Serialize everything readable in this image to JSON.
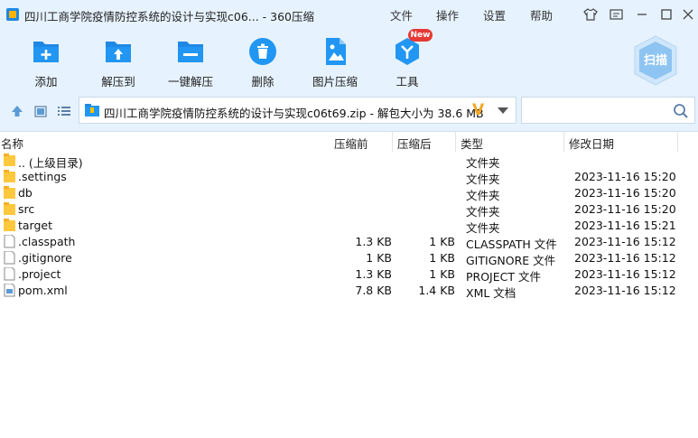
{
  "titlebar": {
    "title": "四川工商学院疫情防控系统的设计与实现c06... - 360压缩",
    "menu": [
      "文件",
      "操作",
      "设置",
      "帮助"
    ]
  },
  "toolbar": {
    "tools": [
      {
        "label": "添加",
        "icon": "add-icon"
      },
      {
        "label": "解压到",
        "icon": "extract-to-icon"
      },
      {
        "label": "一键解压",
        "icon": "one-click-extract-icon"
      },
      {
        "label": "删除",
        "icon": "delete-icon"
      },
      {
        "label": "图片压缩",
        "icon": "image-compress-icon"
      },
      {
        "label": "工具",
        "icon": "tools-icon"
      }
    ],
    "new_badge": "New",
    "scan_label": "扫描"
  },
  "address": {
    "path": "四川工商学院疫情防控系统的设计与实现c06t69.zip - 解包大小为 38.6 MB",
    "v_mark": "V"
  },
  "columns": {
    "name": "名称",
    "compressed": "压缩前",
    "after": "压缩后",
    "type": "类型",
    "modified": "修改日期"
  },
  "files": [
    {
      "name": ".. (上级目录)",
      "before": "",
      "after": "",
      "type": "文件夹",
      "date": "",
      "kind": "folder"
    },
    {
      "name": ".settings",
      "before": "",
      "after": "",
      "type": "文件夹",
      "date": "2023-11-16 15:20",
      "kind": "folder"
    },
    {
      "name": "db",
      "before": "",
      "after": "",
      "type": "文件夹",
      "date": "2023-11-16 15:20",
      "kind": "folder"
    },
    {
      "name": "src",
      "before": "",
      "after": "",
      "type": "文件夹",
      "date": "2023-11-16 15:20",
      "kind": "folder"
    },
    {
      "name": "target",
      "before": "",
      "after": "",
      "type": "文件夹",
      "date": "2023-11-16 15:21",
      "kind": "folder"
    },
    {
      "name": ".classpath",
      "before": "1.3 KB",
      "after": "1 KB",
      "type": "CLASSPATH 文件",
      "date": "2023-11-16 15:12",
      "kind": "file"
    },
    {
      "name": ".gitignore",
      "before": "1 KB",
      "after": "1 KB",
      "type": "GITIGNORE 文件",
      "date": "2023-11-16 15:12",
      "kind": "file"
    },
    {
      "name": ".project",
      "before": "1.3 KB",
      "after": "1 KB",
      "type": "PROJECT 文件",
      "date": "2023-11-16 15:12",
      "kind": "file"
    },
    {
      "name": "pom.xml",
      "before": "7.8 KB",
      "after": "1.4 KB",
      "type": "XML 文档",
      "date": "2023-11-16 15:12",
      "kind": "xml"
    }
  ],
  "colors": {
    "accent": "#1e88e5",
    "chrome_bg": "#e6f2fd",
    "folder": "#ffc83d",
    "badge": "#e53935"
  }
}
